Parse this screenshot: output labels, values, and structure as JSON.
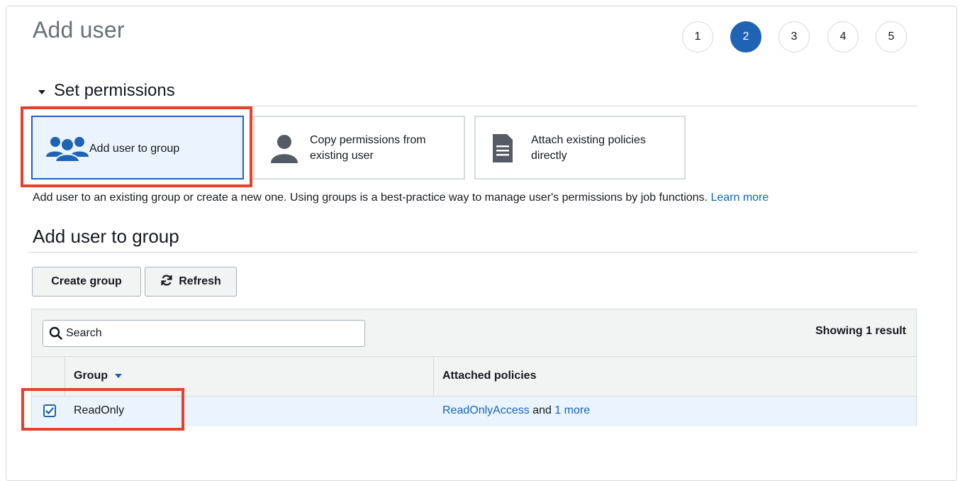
{
  "title": "Add user",
  "steps": [
    "1",
    "2",
    "3",
    "4",
    "5"
  ],
  "active_step": "2",
  "section": {
    "title": "Set permissions"
  },
  "options": [
    {
      "label": "Add user to group",
      "icon": "group-icon",
      "selected": true
    },
    {
      "label_line1": "Copy permissions from",
      "label_line2": "existing user",
      "icon": "user-icon",
      "selected": false
    },
    {
      "label_line1": "Attach existing policies",
      "label_line2": "directly",
      "icon": "document-icon",
      "selected": false
    }
  ],
  "description": {
    "text": "Add user to an existing group or create a new one. Using groups is a best-practice way to manage user's permissions by job functions. ",
    "link": "Learn more"
  },
  "group_section": {
    "title": "Add user to group"
  },
  "buttons": {
    "create": "Create group",
    "refresh": "Refresh"
  },
  "search": {
    "placeholder": "Search"
  },
  "result_count": "Showing 1 result",
  "table": {
    "columns": [
      "Group",
      "Attached policies"
    ],
    "rows": [
      {
        "checked": true,
        "group": "ReadOnly",
        "policy_link": "ReadOnlyAccess",
        "policy_text": " and ",
        "more_link": "1 more"
      }
    ]
  },
  "colors": {
    "accent": "#1f63b4",
    "link": "#1166bb",
    "highlight": "#e8402a",
    "selected_bg": "#eaf3fe"
  }
}
